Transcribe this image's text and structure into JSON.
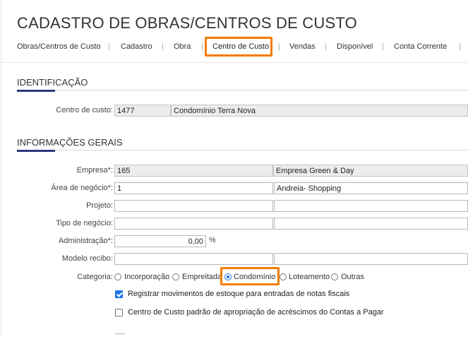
{
  "page": {
    "title": "CADASTRO DE OBRAS/CENTROS DE CUSTO"
  },
  "tabs": [
    {
      "label": "Obras/Centros de Custo"
    },
    {
      "label": "Cadastro"
    },
    {
      "label": "Obra"
    },
    {
      "label": "Centro de Custo",
      "active": true
    },
    {
      "label": "Vendas"
    },
    {
      "label": "Disponível"
    },
    {
      "label": "Conta Corrente"
    }
  ],
  "identificacao": {
    "title": "IDENTIFICAÇÃO",
    "centro_label": "Centro de custo:",
    "centro_code": "1477",
    "centro_name": "Condomínio Terra Nova"
  },
  "gerais": {
    "title": "INFORMAÇÕES GERAIS",
    "empresa_label": "Empresa*:",
    "empresa_code": "165",
    "empresa_name": "Empresa Green & Day",
    "area_label": "Área de negócio*:",
    "area_code": "1",
    "area_name": "Andreia- Shopping",
    "projeto_label": "Projeto:",
    "projeto_code": "",
    "projeto_name": "",
    "tipo_label": "Tipo de negócio:",
    "tipo_code": "",
    "tipo_name": "",
    "admin_label": "Administração*:",
    "admin_value": "0,00",
    "admin_unit": "%",
    "modelo_label": "Modelo recibo:",
    "modelo_code": "",
    "modelo_name": "",
    "categoria_label": "Categoria:",
    "categorias": [
      "Incorporação",
      "Empreitada",
      "Condomínio",
      "Loteamento",
      "Outras"
    ],
    "categoria_selected": "Condomínio",
    "check_estoque": "Registrar movimentos de estoque para entradas de notas fiscais",
    "check_padrao": "Centro de Custo padrão de apropriação de acréscimos do Contas a Pagar"
  },
  "colors": {
    "highlight": "#f07d00",
    "accent": "#2c3a7a",
    "check": "#1a73e8"
  }
}
